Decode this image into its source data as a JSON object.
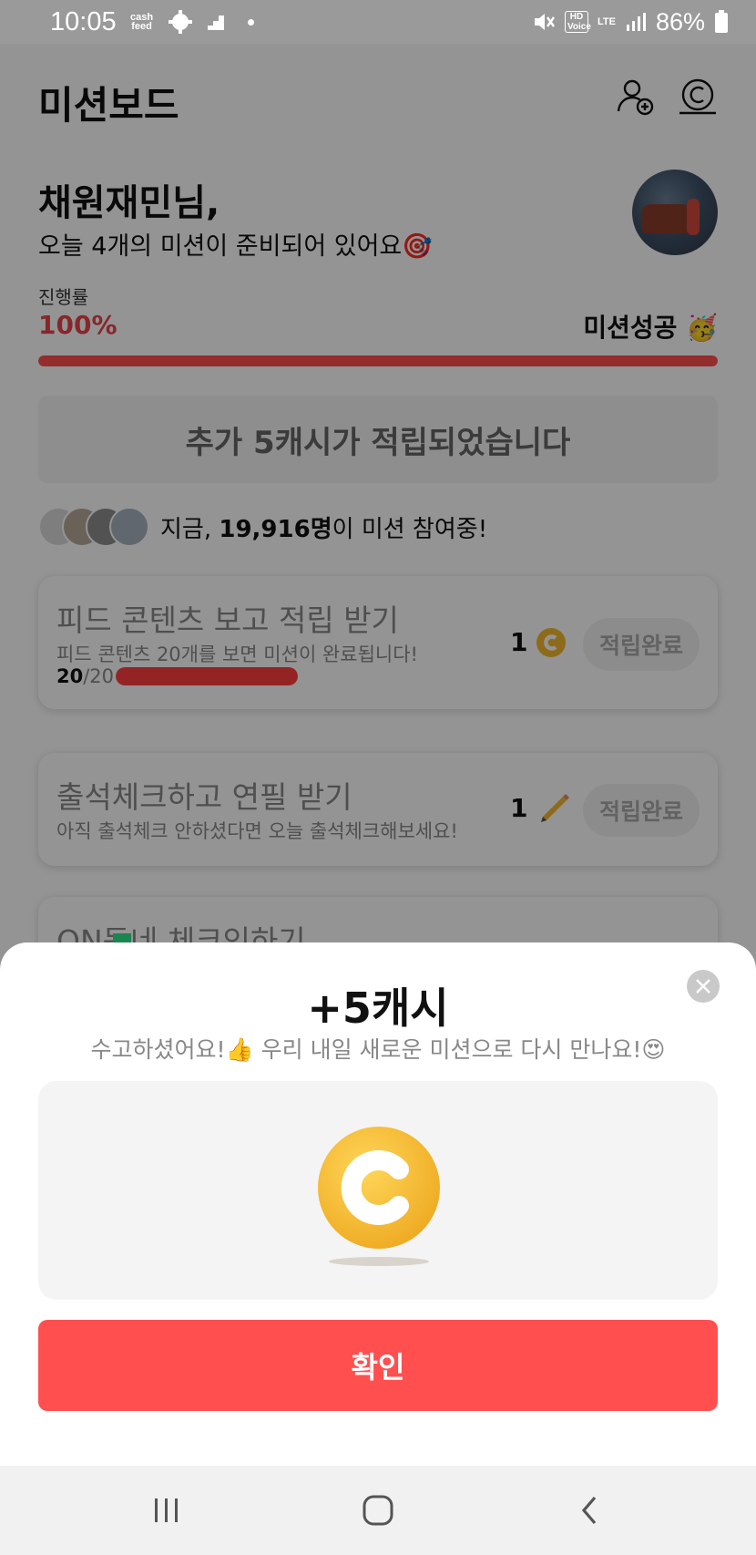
{
  "status_bar": {
    "time": "10:05",
    "battery": "86%",
    "logo_text": "cash feed",
    "hd_label": "HD Voice",
    "lte_label": "LTE"
  },
  "header": {
    "title": "미션보드",
    "icons": [
      "add-friend-icon",
      "coin-stack-icon"
    ]
  },
  "greeting": {
    "name": "채원재민님,",
    "subtitle": "오늘 4개의 미션이 준비되어 있어요🎯"
  },
  "progress": {
    "label": "진행률",
    "value": "100%",
    "fraction": 1.0,
    "status": "미션성공 🥳"
  },
  "bonus": {
    "text": "추가 5캐시가 적립되었습니다"
  },
  "participants": {
    "prefix": "지금, ",
    "count": "19,916명",
    "suffix": "이 미션 참여중!"
  },
  "missions": [
    {
      "title": "피드 콘텐츠 보고 적립 받기",
      "desc": "피드 콘텐츠 20개를 보면 미션이 완료됩니다!",
      "reward": "1",
      "reward_icon": "coin-icon",
      "button": "적립완료",
      "progress_current": "20",
      "progress_total": "/20",
      "progress_fraction": 1.0
    },
    {
      "title": "출석체크하고 연필 받기",
      "desc": "아직 출석체크 안하셨다면 오늘 출석체크해보세요!",
      "reward": "1",
      "reward_icon": "pencil-icon",
      "button": "적립완료"
    },
    {
      "title": "ON동네 체크인하기"
    }
  ],
  "modal": {
    "title": "+5캐시",
    "subtitle": "수고하셨어요!👍 우리 내일 새로운 미션으로 다시 만나요!😍",
    "confirm": "확인"
  },
  "colors": {
    "accent": "#ff4f4f",
    "coin": "#f5b82e"
  }
}
